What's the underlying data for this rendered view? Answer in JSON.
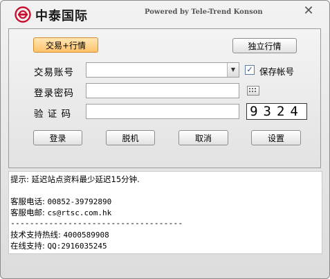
{
  "title": {
    "brand": "中泰国际",
    "powered": "Powered by Tele-Trend Konson",
    "close_glyph": "✕"
  },
  "top_buttons": {
    "trade_quote": "交易+行情",
    "standalone_quote": "独立行情"
  },
  "form": {
    "account_label": "交易账号",
    "account_value": "",
    "save_account_label": "保存帐号",
    "save_account_checked": true,
    "password_label": "登录密码",
    "password_value": "",
    "captcha_label": "验 证 码",
    "captcha_value": "",
    "captcha_code": "9324"
  },
  "actions": {
    "login": "登录",
    "offline": "脱机",
    "cancel": "取消",
    "settings": "设置"
  },
  "info": {
    "hint": "提示: 延迟站点资料最少延迟15分钟.",
    "phone_label": "客服电话: ",
    "phone": "00852-39792890",
    "email_label": "客服电邮: ",
    "email": "cs@rtsc.com.hk",
    "divider": "------------------------------------",
    "hotline_label": "技术支持热线: ",
    "hotline": "4000589908",
    "online_label": "在线支持: ",
    "online": "QQ:2916035245"
  },
  "colors": {
    "active_button": "#ffc36a",
    "logo_red": "#c8102e"
  },
  "icons": {
    "logo": "ring-logo-icon",
    "close": "close-icon",
    "dropdown": "chevron-down-icon",
    "checkbox": "checkmark-icon",
    "keyboard": "keyboard-icon"
  }
}
